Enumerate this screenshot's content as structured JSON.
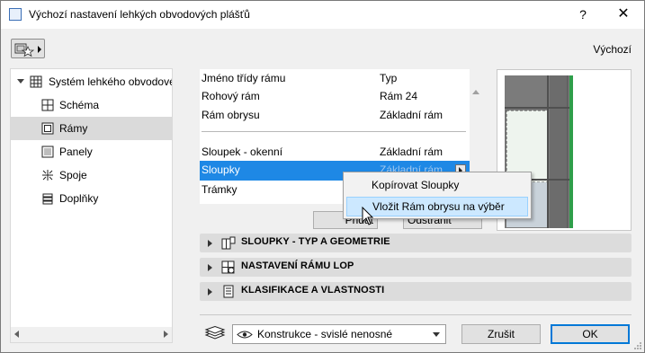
{
  "window": {
    "title": "Výchozí nastavení lehkých obvodových plášťů",
    "help": "?",
    "close": "✕"
  },
  "header": {
    "default_label": "Výchozí"
  },
  "tree": {
    "root_label": "Systém lehkého obvodového pláště",
    "items": [
      {
        "label": "Schéma",
        "icon": "schema-icon"
      },
      {
        "label": "Rámy",
        "icon": "frame-icon",
        "selected": true
      },
      {
        "label": "Panely",
        "icon": "panel-icon"
      },
      {
        "label": "Spoje",
        "icon": "junction-icon"
      },
      {
        "label": "Doplňky",
        "icon": "accessory-icon"
      }
    ]
  },
  "frame_list": {
    "rows": [
      {
        "name": "Jméno třídy rámu",
        "value": "Typ"
      },
      {
        "name": "Rohový rám",
        "value": "Rám 24"
      },
      {
        "name": "Rám obrysu",
        "value": "Základní rám"
      },
      {
        "name": "Sloupek - okenní",
        "value": "Základní rám"
      },
      {
        "name": "Sloupky",
        "value": "Základní rám",
        "selected": true
      },
      {
        "name": "Trámky",
        "value": ""
      }
    ]
  },
  "list_buttons": {
    "left_partial": "Přidat",
    "right_partial": "Odstranit"
  },
  "context_menu": {
    "items": [
      {
        "label": "Kopírovat Sloupky"
      },
      {
        "label": "Vložit Rám obrysu na výběr",
        "highlighted": true
      }
    ]
  },
  "panels": [
    {
      "title": "SLOUPKY - TYP A GEOMETRIE",
      "icon": "mullion-geometry-icon"
    },
    {
      "title": "NASTAVENÍ RÁMU LOP",
      "icon": "frame-settings-icon"
    },
    {
      "title": "KLASIFIKACE A VLASTNOSTI",
      "icon": "classification-icon"
    }
  ],
  "footer": {
    "layer_value": "Konstrukce - svislé nenosné",
    "cancel_label": "Zrušit",
    "ok_label": "OK"
  },
  "colors": {
    "selection": "#1e88e5",
    "preview_frame": "#808080",
    "preview_green": "#2e9e4a",
    "ok_border": "#0078d7"
  }
}
